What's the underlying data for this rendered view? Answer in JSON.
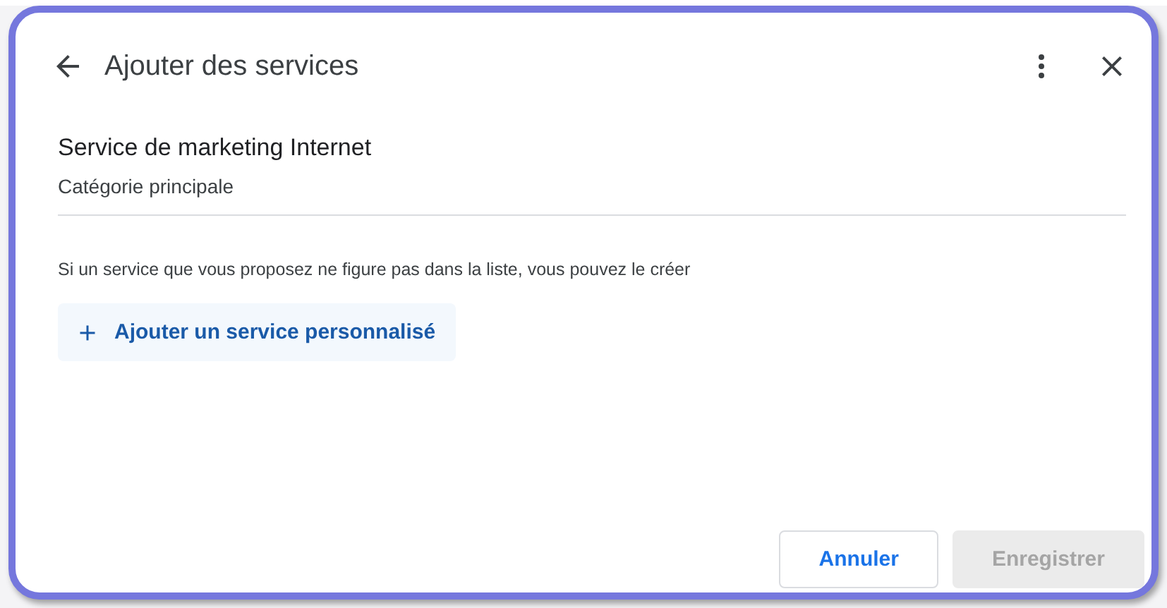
{
  "header": {
    "title": "Ajouter des services"
  },
  "service": {
    "name": "Service de marketing Internet",
    "category": "Catégorie principale"
  },
  "hint": "Si un service que vous proposez ne figure pas dans la liste, vous pouvez le créer",
  "add_button": {
    "label": "Ajouter un service personnalisé"
  },
  "actions": [
    {
      "label": "Annuler",
      "disabled": false
    },
    {
      "label": "Enregistrer",
      "disabled": true
    }
  ]
}
